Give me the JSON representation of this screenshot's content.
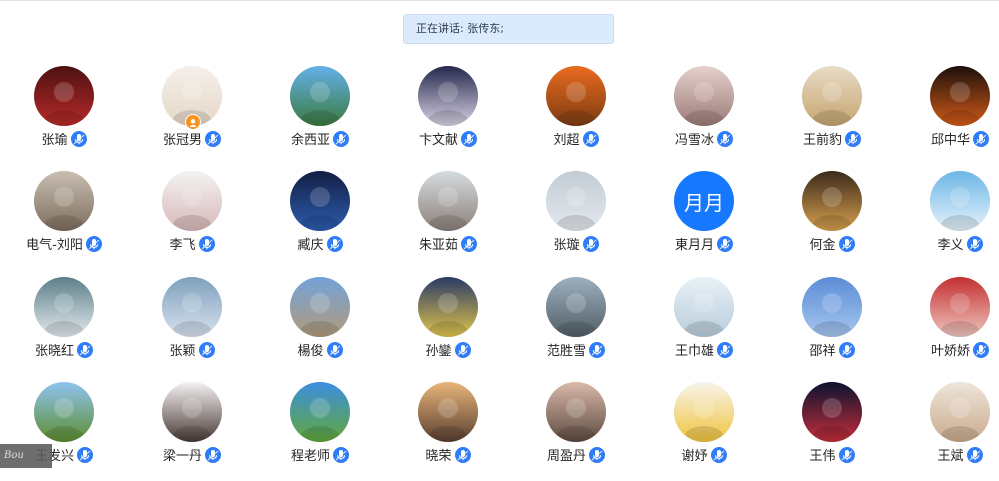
{
  "speaking": {
    "text": "正在讲话: 张传东;"
  },
  "participants": [
    {
      "name": "张瑜",
      "colors": [
        "#4d1010",
        "#b82a2a"
      ]
    },
    {
      "name": "张冠男",
      "colors": [
        "#f3f0ea",
        "#e7d7c7"
      ]
    },
    {
      "name": "余西亚",
      "colors": [
        "#63b1ea",
        "#3b7a3e"
      ]
    },
    {
      "name": "卞文献",
      "colors": [
        "#25284d",
        "#d9d2e5"
      ]
    },
    {
      "name": "刘超",
      "colors": [
        "#e96b1f",
        "#7d3c12"
      ]
    },
    {
      "name": "冯雪冰",
      "colors": [
        "#e6d1cc",
        "#9b7b77"
      ]
    },
    {
      "name": "王前豹",
      "colors": [
        "#e8dcc6",
        "#c6a46f"
      ]
    },
    {
      "name": "邱中华",
      "colors": [
        "#1b0f0b",
        "#d45b18"
      ]
    },
    {
      "name": "电气-刘阳",
      "colors": [
        "#c9beb1",
        "#7d6e5e"
      ]
    },
    {
      "name": "李飞",
      "colors": [
        "#f4f2f2",
        "#d8b8b8"
      ]
    },
    {
      "name": "臧庆",
      "colors": [
        "#121e43",
        "#2d5db0"
      ]
    },
    {
      "name": "朱亚茹",
      "colors": [
        "#d6dce0",
        "#8b8079"
      ]
    },
    {
      "name": "张璇",
      "colors": [
        "#c2ccd4",
        "#e4e8ee"
      ]
    },
    {
      "name": "東月月",
      "avatar_text": "月月",
      "colors": [
        "#1677ff",
        "#1677ff"
      ]
    },
    {
      "name": "何金",
      "colors": [
        "#3a2a1a",
        "#d8a04e"
      ]
    },
    {
      "name": "李义",
      "colors": [
        "#6db7e6",
        "#e7f2fb"
      ]
    },
    {
      "name": "张晓红",
      "colors": [
        "#5e7f8a",
        "#e2eaee"
      ]
    },
    {
      "name": "张颖",
      "colors": [
        "#7fa0bd",
        "#d8e3ef"
      ]
    },
    {
      "name": "楊俊",
      "colors": [
        "#73a3d9",
        "#b29a7b"
      ]
    },
    {
      "name": "孙鑾",
      "colors": [
        "#2a3a65",
        "#e1c54c"
      ]
    },
    {
      "name": "范胜雪",
      "colors": [
        "#9cb0c0",
        "#525e66"
      ]
    },
    {
      "name": "王巾雄",
      "colors": [
        "#e8f1f6",
        "#b8ccdc"
      ]
    },
    {
      "name": "邵祥",
      "colors": [
        "#5c8dd6",
        "#a6c6ee"
      ]
    },
    {
      "name": "叶娇娇",
      "colors": [
        "#c23030",
        "#f0c6c0"
      ]
    },
    {
      "name": "王发兴",
      "colors": [
        "#8ec3f0",
        "#5e8e2f"
      ]
    },
    {
      "name": "梁一丹",
      "colors": [
        "#f4f2f2",
        "#4a3a36"
      ]
    },
    {
      "name": "程老师",
      "colors": [
        "#3c8ee0",
        "#62a83a"
      ]
    },
    {
      "name": "晓荣",
      "colors": [
        "#e8b47a",
        "#5a4031"
      ]
    },
    {
      "name": "周盈丹",
      "colors": [
        "#d9b9a9",
        "#5d4a40"
      ]
    },
    {
      "name": "谢妤",
      "colors": [
        "#f7f4ec",
        "#f0c43c"
      ]
    },
    {
      "name": "王伟",
      "colors": [
        "#0c1230",
        "#c52d3a"
      ]
    },
    {
      "name": "王斌",
      "colors": [
        "#efe6da",
        "#c9a98c"
      ]
    }
  ],
  "icons": {
    "mic": "microphone-icon",
    "host": "host-badge-icon"
  },
  "accent_color": "#2f7cf6",
  "corner_logo": "Bou"
}
